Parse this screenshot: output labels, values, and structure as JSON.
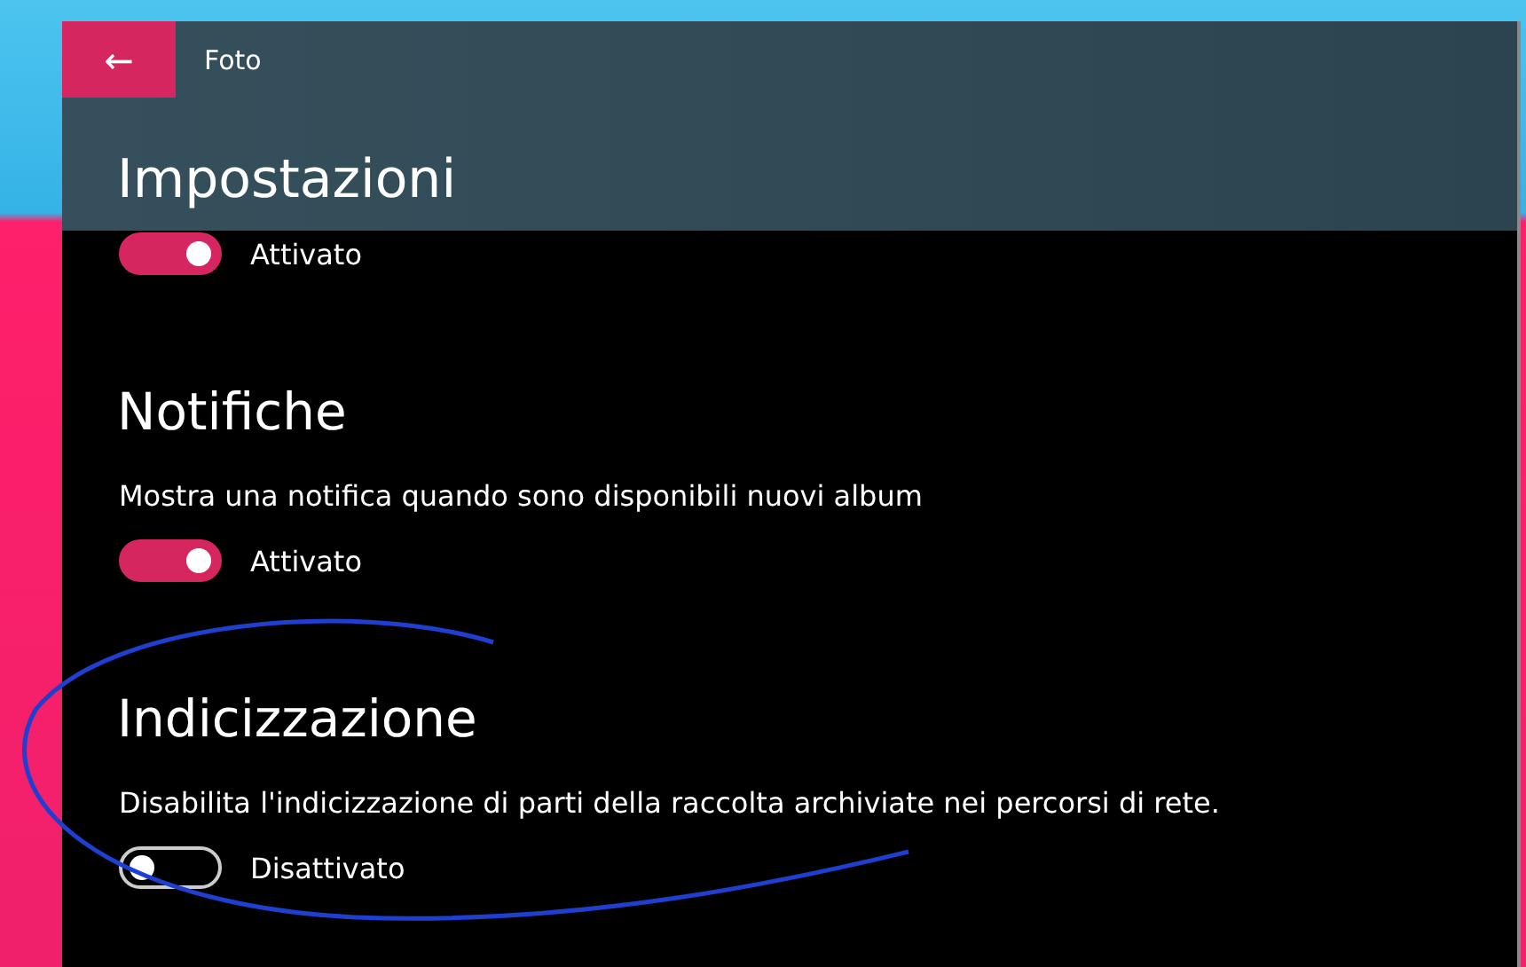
{
  "window": {
    "back_button": "←",
    "title": "Foto"
  },
  "page": {
    "title": "Impostazioni"
  },
  "sections": [
    {
      "toggle": {
        "on": true,
        "label": "Attivato"
      }
    },
    {
      "heading": "Notifiche",
      "description": "Mostra una notifica quando sono disponibili nuovi album",
      "toggle": {
        "on": true,
        "label": "Attivato"
      }
    },
    {
      "heading": "Indicizzazione",
      "description": "Disabilita l'indicizzazione di parti della raccolta archiviate nei percorsi di rete.",
      "toggle": {
        "on": false,
        "label": "Disattivato"
      }
    }
  ]
}
